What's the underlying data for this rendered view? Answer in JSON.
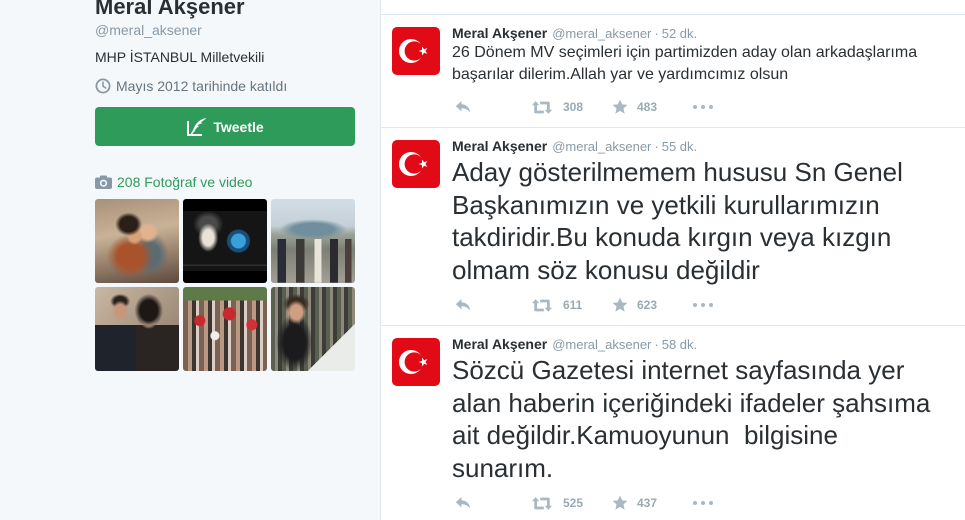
{
  "colors": {
    "accent": "#2e9b5a",
    "text": "#292f33",
    "muted": "#8899a6",
    "secondary": "#66757f",
    "border": "#e1e8ed",
    "sidebar_bg": "#f5f8fa",
    "flag_red": "#e30a17",
    "action": "#aab8c2"
  },
  "icons": {
    "join_date": "clock-icon",
    "tweet_button": "quill-icon",
    "media_link": "camera-icon",
    "tweet_avatar": "turkish-flag-avatar",
    "reply": "reply-icon",
    "retweet": "retweet-icon",
    "favorite": "star-icon",
    "more": "more-icon"
  },
  "profile": {
    "name": "Meral Akşener",
    "handle": "@meral_aksener",
    "bio": "MHP İSTANBUL Milletvekili",
    "joined": "Mayıs 2012 tarihinde katıldı",
    "tweet_button_label": "Tweetle",
    "media_link_label": "208 Fotoğraf ve video"
  },
  "tweets": [
    {
      "author": "Meral Akşener",
      "handle": "@meral_aksener",
      "separator": "·",
      "time": "52 dk.",
      "lines": [
        "26 Dönem MV seçimleri için partimizden aday olan arkadaşlarıma",
        "başarılar dilerim.Allah yar ve yardımcımız olsun"
      ],
      "retweets": 308,
      "favorites": 483
    },
    {
      "author": "Meral Akşener",
      "handle": "@meral_aksener",
      "separator": "·",
      "time": "55 dk.",
      "lines": [
        "Aday gösterilmemem hususu Sn Genel",
        "Başkanımızın ve yetkili kurullarımızın",
        "takdiridir.Bu konuda kırgın veya kızgın",
        "olmam söz konusu değildir"
      ],
      "retweets": 611,
      "favorites": 623
    },
    {
      "author": "Meral Akşener",
      "handle": "@meral_aksener",
      "separator": "·",
      "time": "58 dk.",
      "lines": [
        "Sözcü Gazetesi internet sayfasında yer",
        "alan haberin içeriğindeki ifadeler şahsıma",
        "ait değildir.Kamuoyunun  bilgisine",
        "sunarım."
      ],
      "retweets": 525,
      "favorites": 437
    }
  ]
}
